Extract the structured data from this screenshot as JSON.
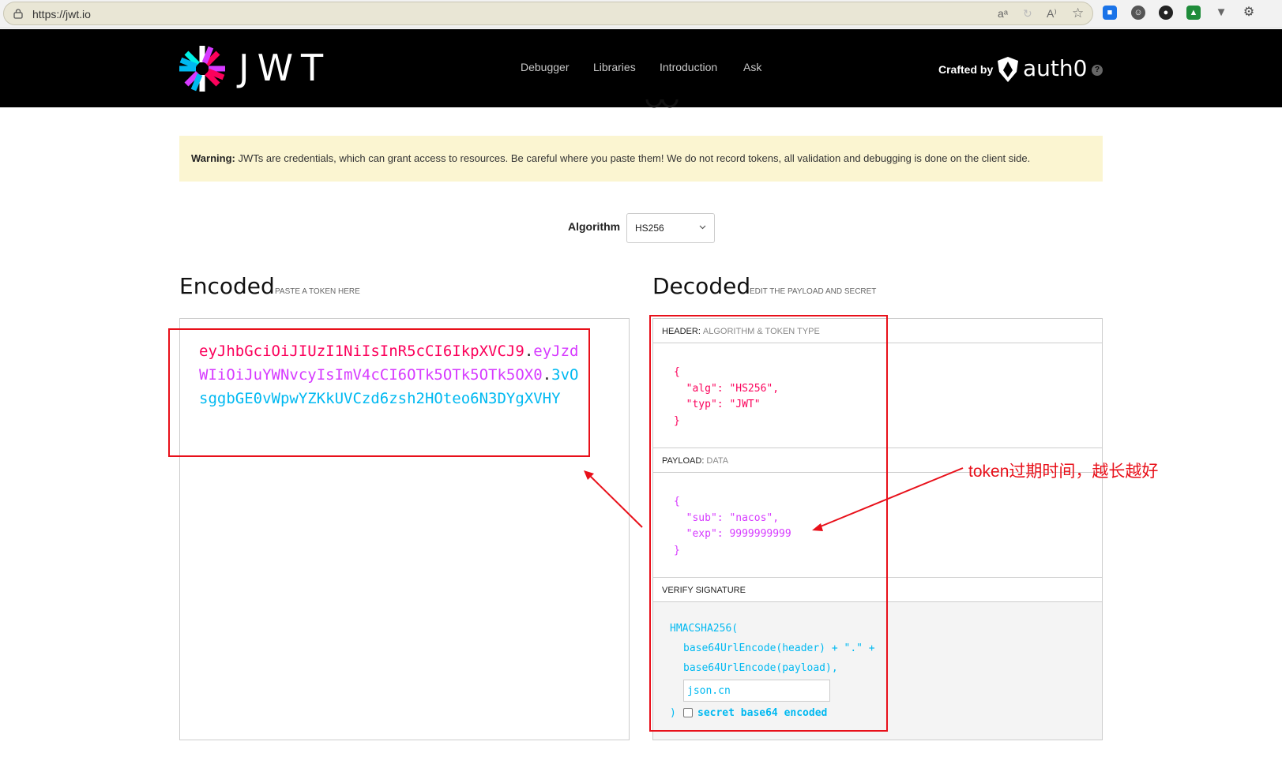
{
  "browser": {
    "url": "https://jwt.io",
    "icons": [
      "lock-icon",
      "translate-icon",
      "refresh-icon",
      "read-aloud-icon",
      "favorite-star-icon",
      "extension-icons",
      "extensions-puzzle-icon"
    ]
  },
  "nav": {
    "logo_text": "JWT",
    "links": [
      "Debugger",
      "Libraries",
      "Introduction",
      "Ask"
    ],
    "crafted_by": "Crafted by",
    "brand": "auth0"
  },
  "warning": {
    "label": "Warning:",
    "text": "JWTs are credentials, which can grant access to resources. Be careful where you paste them! We do not record tokens, all validation and debugging is done on the client side."
  },
  "algorithm": {
    "label": "Algorithm",
    "value": "HS256"
  },
  "encoded": {
    "title": "Encoded",
    "subtitle": "PASTE A TOKEN HERE",
    "header_part": "eyJhbGciOiJIUzI1NiIsInR5cCI6IkpXVCJ9",
    "dot1": ".",
    "payload_part": "eyJzdWIiOiJuYWNvcyIsImV4cCI6OTk5OTk5OTk5OX0",
    "dot2": ".",
    "signature_part": "3vOsggbGE0vWpwYZKkUVCzd6zsh2HOteo6N3DYgXVHY"
  },
  "decoded": {
    "title": "Decoded",
    "subtitle": "EDIT THE PAYLOAD AND SECRET",
    "header": {
      "label": "HEADER:",
      "sublabel": "ALGORITHM & TOKEN TYPE",
      "lines": [
        "{",
        "  \"alg\": \"HS256\",",
        "  \"typ\": \"JWT\"",
        "}"
      ]
    },
    "payload": {
      "label": "PAYLOAD:",
      "sublabel": "DATA",
      "lines": [
        "{",
        "  \"sub\": \"nacos\",",
        "  \"exp\": 9999999999",
        "}"
      ]
    },
    "signature": {
      "label": "VERIFY SIGNATURE",
      "func": "HMACSHA256(",
      "line1": "base64UrlEncode(header) + \".\" +",
      "line2": "base64UrlEncode(payload),",
      "secret": "json.cn",
      "close": ")",
      "checkbox_label": "secret base64 encoded"
    }
  },
  "annotation": {
    "text": "token过期时间，越长越好",
    "color": "#e8101a"
  }
}
